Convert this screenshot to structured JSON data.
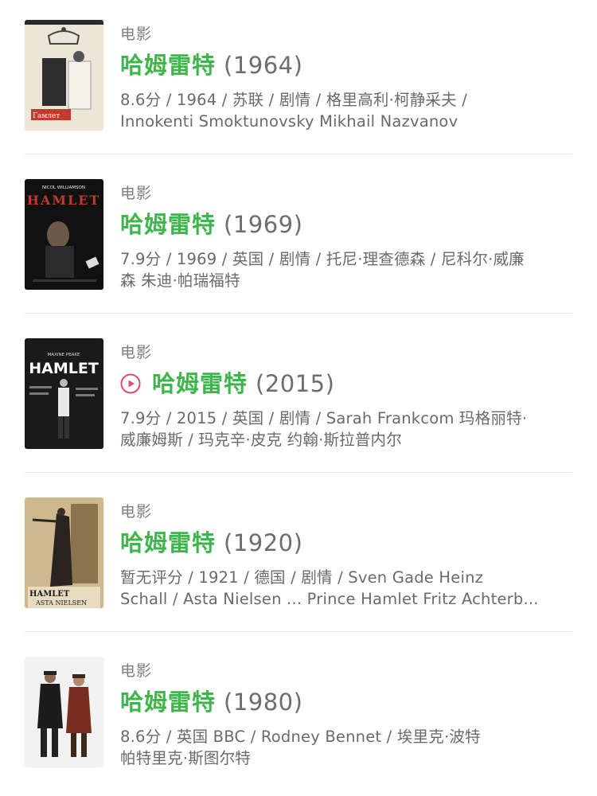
{
  "results": [
    {
      "category": "电影",
      "title": "哈姆雷特",
      "year": "(1964)",
      "has_play": false,
      "meta_line1": "8.6分 / 1964 / 苏联 / 剧情 / 格里高利·柯静采夫 /",
      "meta_line2": "Innokenti Smoktunovsky Mikhail Nazvanov",
      "poster_text": "Гамлет"
    },
    {
      "category": "电影",
      "title": "哈姆雷特",
      "year": "(1969)",
      "has_play": false,
      "meta_line1": "7.9分 / 1969 / 英国 / 剧情 / 托尼·理查德森 / 尼科尔·威廉",
      "meta_line2": "森 朱迪·帕瑞福特",
      "poster_text": "HAMLET",
      "poster_top": "NICOL WILLIAMSON"
    },
    {
      "category": "电影",
      "title": "哈姆雷特",
      "year": "(2015)",
      "has_play": true,
      "meta_line1": "7.9分 / 2015 / 英国 / 剧情 / Sarah Frankcom 玛格丽特·",
      "meta_line2": "威廉姆斯 / 玛克辛·皮克 约翰·斯拉普内尔",
      "poster_text": "HAMLET",
      "poster_top": "MAXINE PEAKE"
    },
    {
      "category": "电影",
      "title": "哈姆雷特",
      "year": "(1920)",
      "has_play": false,
      "meta_line1": "暂无评分 / 1921 / 德国 / 剧情 / Sven Gade Heinz",
      "meta_line2": "Schall / Asta Nielsen ...  Prince Hamlet Fritz Achterb...",
      "poster_text": "HAMLET",
      "poster_bottom": "ASTA NIELSEN"
    },
    {
      "category": "电影",
      "title": "哈姆雷特",
      "year": "(1980)",
      "has_play": false,
      "meta_line1": "8.6分 / 英国 BBC / Rodney Bennet / 埃里克·波特",
      "meta_line2": "帕特里克·斯图尔特"
    }
  ],
  "colors": {
    "title_green": "#3fb54c",
    "play_pink": "#e04a74"
  }
}
